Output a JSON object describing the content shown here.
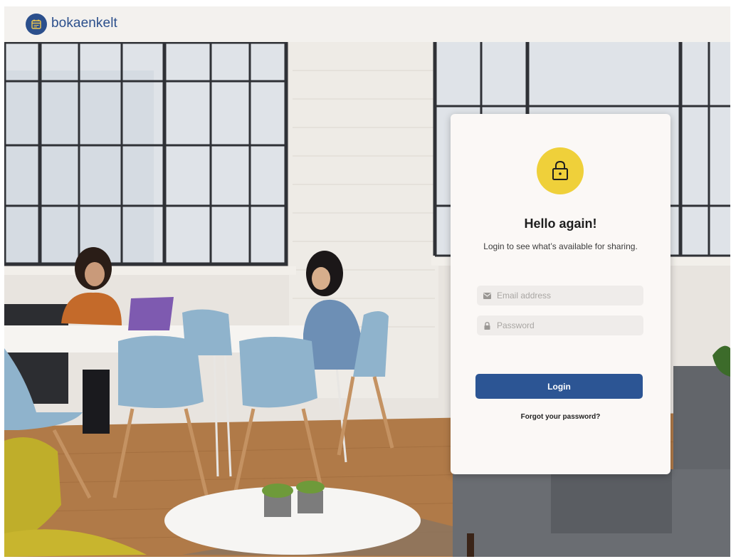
{
  "header": {
    "brand": "bokaenkelt"
  },
  "login_card": {
    "title": "Hello again!",
    "subtitle": "Login to see what’s available for sharing.",
    "email": {
      "placeholder": "Email address",
      "value": ""
    },
    "password": {
      "placeholder": "Password",
      "value": ""
    },
    "login_label": "Login",
    "forgot_label": "Forgot your password?"
  },
  "colors": {
    "brand": "#2b4f8c",
    "accent_yellow": "#efd03a",
    "button": "#2c5594",
    "card": "#fbf8f6"
  },
  "icons": [
    "calendar-logo-icon",
    "lock-icon",
    "envelope-icon",
    "padlock-icon"
  ]
}
